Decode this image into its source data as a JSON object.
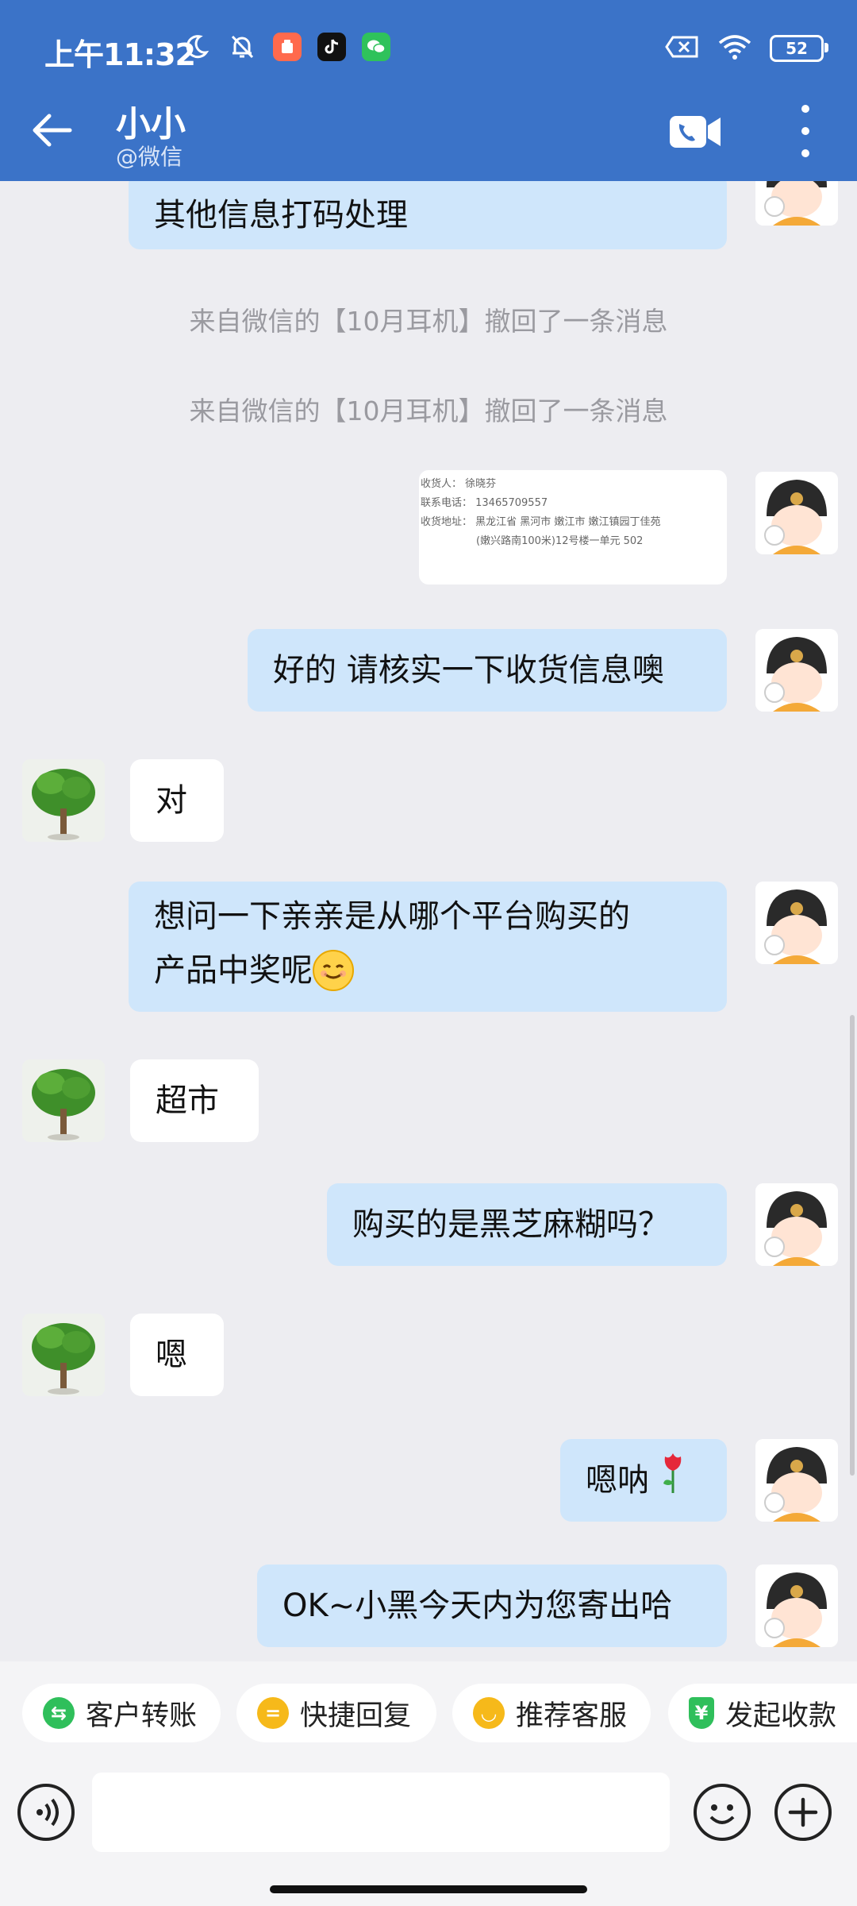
{
  "status_bar": {
    "time": "上午11:32",
    "battery": "52"
  },
  "header": {
    "contact_name": "小小",
    "source": "@微信"
  },
  "messages": {
    "m1": "其他信息打码处理",
    "sys1": "来自微信的【10月耳机】撤回了一条消息",
    "sys2": "来自微信的【10月耳机】撤回了一条消息",
    "card": {
      "line1": "收货人：  徐晓芬",
      "line2": "联系电话：  13465709557",
      "line3": "收货地址：  黑龙江省 黑河市 嫩江市 嫩江镇园丁佳苑",
      "line4": "(嫩兴路南100米)12号楼一单元 502"
    },
    "m2": "好的 请核实一下收货信息噢",
    "m3": "对",
    "m4_line1": "想问一下亲亲是从哪个平台购买的",
    "m4_line2": "产品中奖呢",
    "m5": "超市",
    "m6": "购买的是黑芝麻糊吗？",
    "m7": "嗯",
    "m8": "嗯呐",
    "m9": "OK~小黑今天内为您寄出哈"
  },
  "quick_actions": [
    {
      "label": "客户转账",
      "icon": "transfer-icon",
      "color": "#2fbf5b"
    },
    {
      "label": "快捷回复",
      "icon": "quick-reply-icon",
      "color": "#f6b91a"
    },
    {
      "label": "推荐客服",
      "icon": "recommend-icon",
      "color": "#f6b91a"
    },
    {
      "label": "发起收款",
      "icon": "payment-shield-icon",
      "color": "#2fbf5b"
    }
  ],
  "input": {
    "placeholder": ""
  },
  "colors": {
    "header_bg": "#3b73c8",
    "my_bubble": "#cfe6fb",
    "their_bubble": "#ffffff",
    "chat_bg": "#ededf1"
  }
}
